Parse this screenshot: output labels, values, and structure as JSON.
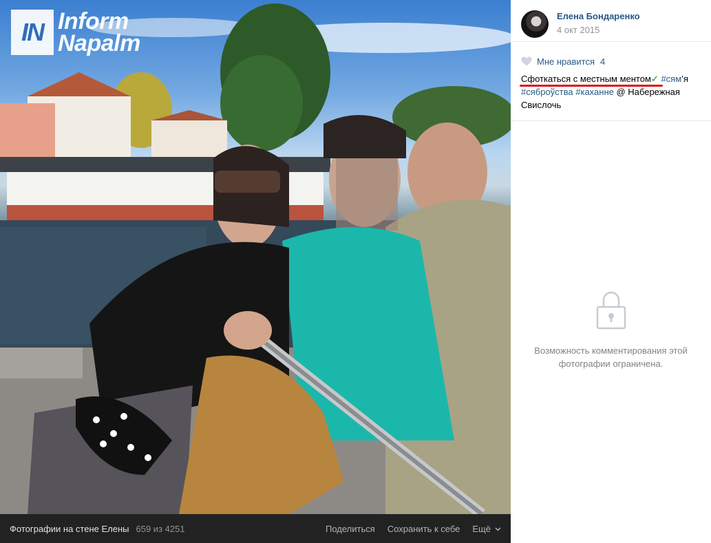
{
  "photo": {
    "watermark_badge": "IN",
    "watermark_line1": "Inform",
    "watermark_line2": "Napalm"
  },
  "bottom_bar": {
    "title": "Фотографии на стене Елены",
    "count": "659 из 4251",
    "share_label": "Поделиться",
    "save_label": "Сохранить к себе",
    "more_label": "Ещё"
  },
  "author": {
    "name": "Елена Бондаренко",
    "date": "4 окт 2015"
  },
  "likes": {
    "label": "Мне нравится",
    "count": "4"
  },
  "caption": {
    "highlighted": "Сфоткаться с местным ментом",
    "check": "✓",
    "tag1": "#сям",
    "tag1_suffix": "’я",
    "tag2": "#сяброўства",
    "tag3": "#каханне",
    "location": "@ Набережная Свислочь"
  },
  "comments": {
    "restricted_text": "Возможность комментирования этой фотографии ограничена."
  },
  "colors": {
    "link": "#2a5885",
    "underline": "#dd1111",
    "bottom_bar_bg": "#222222"
  },
  "icons": [
    "heart-icon",
    "lock-icon",
    "chevron-down-icon"
  ]
}
